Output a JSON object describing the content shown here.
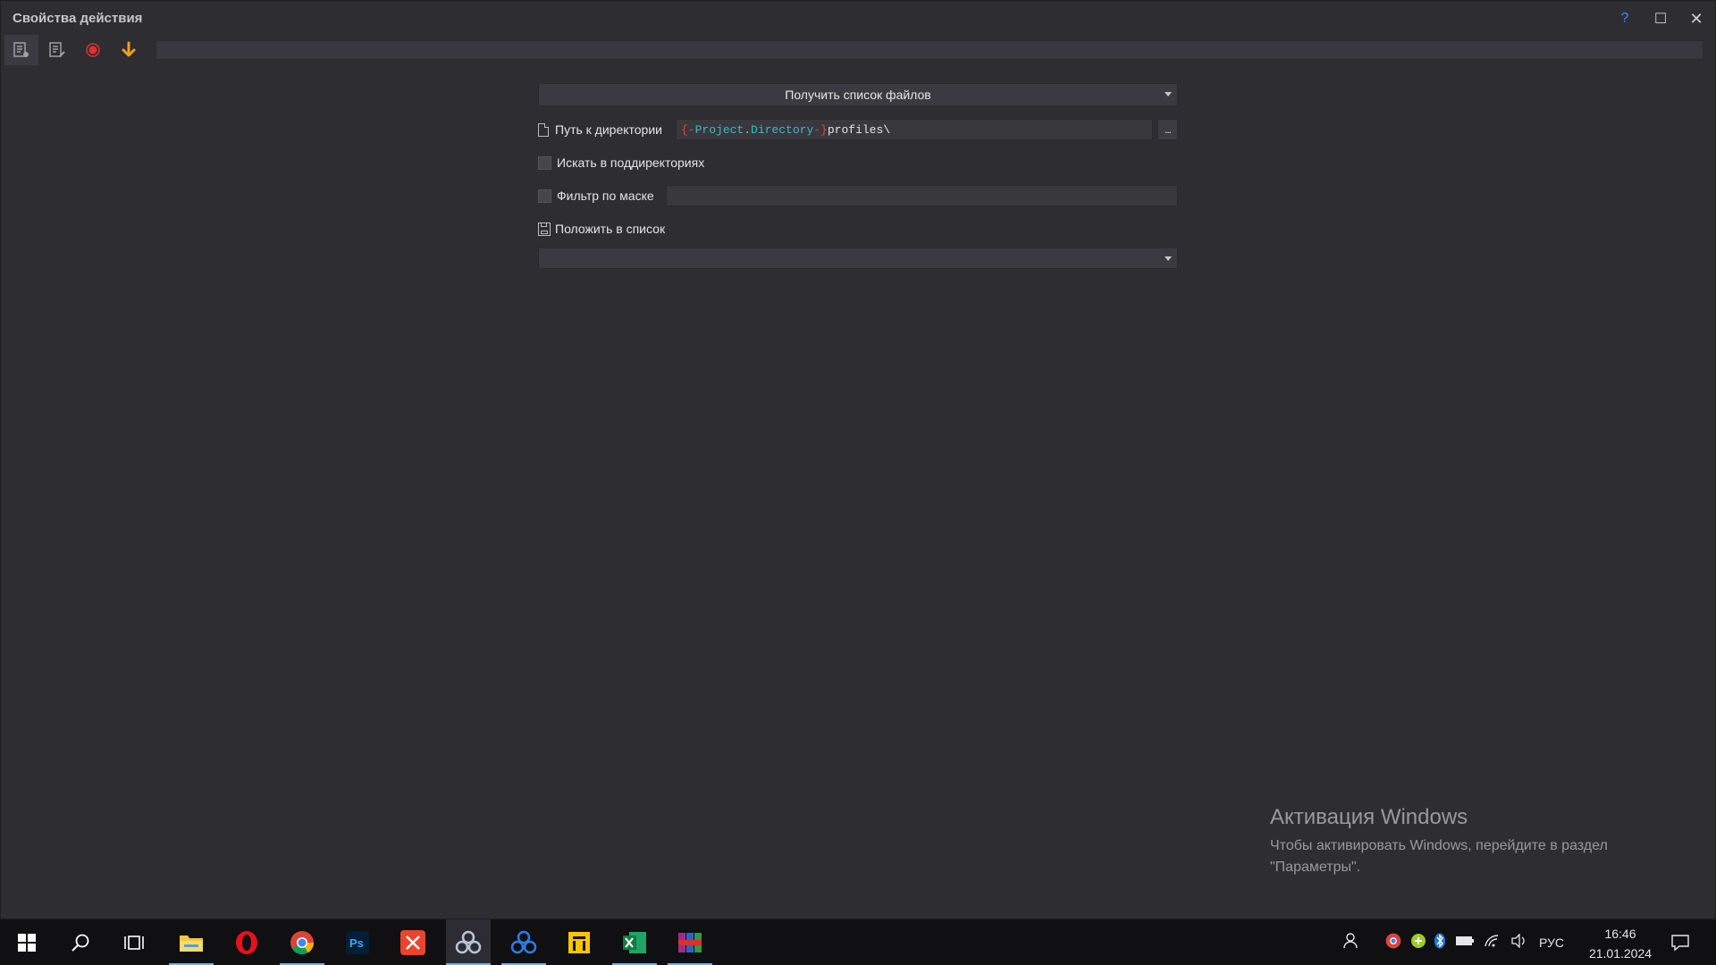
{
  "window": {
    "title": "Свойства действия",
    "help_label": "?",
    "maximize_glyph": "☐",
    "close_glyph": "✕"
  },
  "toolbar": {
    "icons": [
      "properties-icon",
      "edit-list-icon",
      "record-icon",
      "download-arrow-icon"
    ],
    "record_color": "#e03030",
    "arrow_color": "#f0a020"
  },
  "action": {
    "selected": "Получить список файлов"
  },
  "form": {
    "dir_label": "Путь к директории",
    "dir_tokens": {
      "open": "{-",
      "project": "Project",
      "dot": ".",
      "directory": "Directory",
      "close": "-}",
      "rest": "profiles\\"
    },
    "browse_label": "...",
    "subdirs_label": "Искать в поддиректориях",
    "mask_label": "Фильтр по маске",
    "mask_value": "",
    "put_label": "Положить в список",
    "list_selected": ""
  },
  "activation": {
    "title": "Активация Windows",
    "text": "Чтобы активировать Windows, перейдите в раздел \"Параметры\"."
  },
  "taskbar": {
    "apps": [
      "windows-start-icon",
      "search-icon",
      "task-view-icon",
      "file-explorer-icon",
      "opera-icon",
      "chrome-icon",
      "photoshop-icon",
      "xmind-icon",
      "zennoposter-icon",
      "zennoposter-blue-icon",
      "sticky-app-icon",
      "excel-icon",
      "winrar-icon"
    ],
    "language": "РУС",
    "time": "16:46",
    "date": "21.01.2024"
  }
}
